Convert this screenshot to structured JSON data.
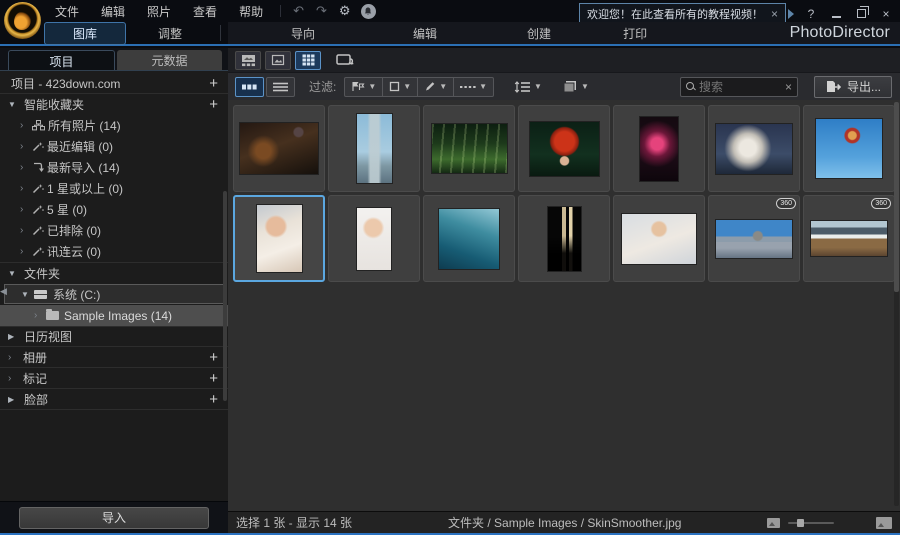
{
  "titlebar": {
    "menu": [
      "文件",
      "编辑",
      "照片",
      "查看",
      "帮助"
    ],
    "notification_text": "欢迎您！在此查看所有的教程视频！",
    "notification_close": "×",
    "help_label": "?"
  },
  "tabs": {
    "library": "图库",
    "adjust": "调整",
    "guided": "导向",
    "edit": "编辑",
    "create": "创建",
    "print": "打印"
  },
  "app_title": "PhotoDirector",
  "sidebar": {
    "tab_project": "项目",
    "tab_metadata": "元数据",
    "project_row": "项目 - 423down.com",
    "smart_header": "智能收藏夹",
    "smart_items": [
      {
        "label": "所有照片 (14)",
        "icon": "photo-tree-icon"
      },
      {
        "label": "最近编辑 (0)",
        "icon": "magic-wand-icon"
      },
      {
        "label": "最新导入 (14)",
        "icon": "import-arrow-icon"
      },
      {
        "label": "1 星或以上 (0)",
        "icon": "magic-wand-icon"
      },
      {
        "label": "5 星 (0)",
        "icon": "magic-wand-icon"
      },
      {
        "label": "已排除 (0)",
        "icon": "magic-wand-icon"
      },
      {
        "label": "讯连云 (0)",
        "icon": "magic-wand-icon"
      }
    ],
    "folders_header": "文件夹",
    "drive_row": "系统 (C:)",
    "folder_row": "Sample Images (14)",
    "calendar_row": "日历视图",
    "albums_row": "相册",
    "tags_row": "标记",
    "faces_row": "脸部",
    "import_button": "导入"
  },
  "browser": {
    "filter_label": "过滤:",
    "search_placeholder": "搜索",
    "export_label": "导出...",
    "badge_360": "360"
  },
  "photos": [
    {
      "name": "basketball-dunk"
    },
    {
      "name": "skyscraper-sail"
    },
    {
      "name": "sunlit-forest"
    },
    {
      "name": "red-maple-leaf"
    },
    {
      "name": "pink-neon-sign"
    },
    {
      "name": "rocket-launch-smoke"
    },
    {
      "name": "snowboarder-jump"
    },
    {
      "name": "woman-smiling-portrait",
      "selected": true
    },
    {
      "name": "woman-laughing-portrait"
    },
    {
      "name": "ocean-wave"
    },
    {
      "name": "dark-window-blinds"
    },
    {
      "name": "woman-leaning-portrait"
    },
    {
      "name": "panorama-360-beach",
      "badge": "360"
    },
    {
      "name": "panorama-360-canyon",
      "badge": "360"
    }
  ],
  "statusbar": {
    "selection": "选择 1 张 - 显示 14 张",
    "path": "文件夹 / Sample Images / SkinSmoother.jpg"
  }
}
